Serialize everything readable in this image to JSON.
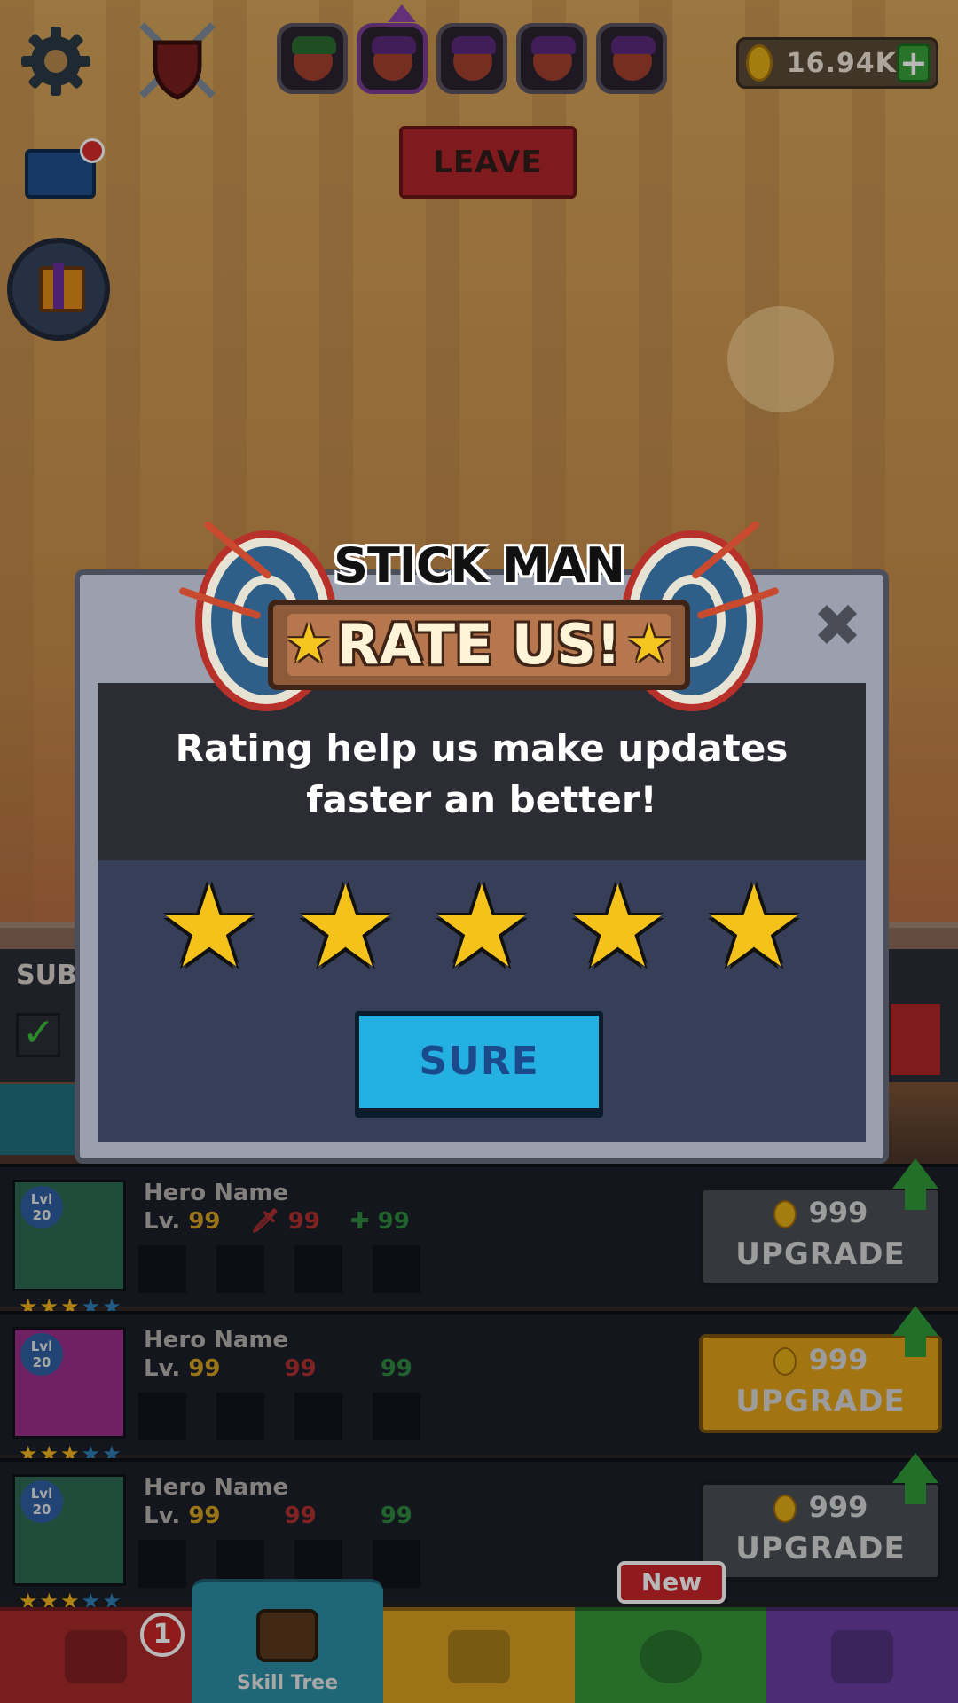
{
  "hud": {
    "coins": "16.94K",
    "plus": "+",
    "leave_label": "LEAVE"
  },
  "game": {
    "sub_label": "SUB"
  },
  "heroes": [
    {
      "lvl_badge": "Lvl 20",
      "name": "Hero Name",
      "lv_prefix": "Lv.",
      "level": "99",
      "attack": "99",
      "health": "99",
      "price": "999",
      "button": "UPGRADE",
      "button_style": "gray"
    },
    {
      "lvl_badge": "Lvl 20",
      "name": "Hero Name",
      "lv_prefix": "Lv.",
      "level": "99",
      "attack": "99",
      "health": "99",
      "price": "999",
      "button": "UPGRADE",
      "button_style": "gold"
    },
    {
      "lvl_badge": "Lvl 20",
      "name": "Hero Name",
      "lv_prefix": "Lv.",
      "level": "99",
      "attack": "99",
      "health": "99",
      "price": "999",
      "button": "UPGRADE",
      "button_style": "gray"
    }
  ],
  "modal": {
    "title_small": "STICK MAN",
    "title_big": "RATE US!",
    "message_line1": "Rating help us make updates",
    "message_line2": "faster an better!",
    "close": "✖",
    "rating": 5,
    "button": "SURE"
  },
  "nav": {
    "chest_badge": "1",
    "skill_label": "Skill Tree",
    "new_tag": "New"
  },
  "colors": {
    "sure_button": "#24b1e2",
    "star": "#f5c21c",
    "banner": "#8d5a3a"
  }
}
